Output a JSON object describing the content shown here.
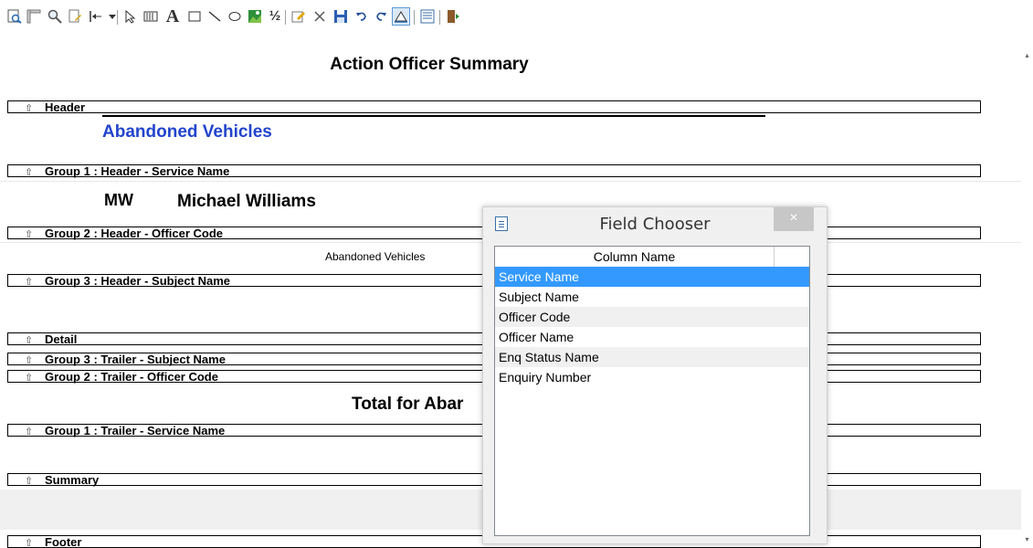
{
  "toolbar": {
    "tools": [
      {
        "name": "print-preview-icon",
        "glyph": "🔍"
      },
      {
        "name": "ruler-icon",
        "glyph": "📐"
      },
      {
        "name": "zoom-icon",
        "glyph": "🔎"
      },
      {
        "name": "properties-icon",
        "glyph": "📝"
      },
      {
        "name": "align-left-icon",
        "glyph": "⇤"
      },
      {
        "name": "align-dropdown-icon",
        "glyph": "▾"
      },
      {
        "name": "pointer-icon",
        "glyph": "⇖"
      },
      {
        "name": "field-icon",
        "glyph": "▦"
      },
      {
        "name": "text-icon",
        "glyph": "A"
      },
      {
        "name": "rectangle-icon",
        "glyph": "□"
      },
      {
        "name": "line-icon",
        "glyph": "╲"
      },
      {
        "name": "ellipse-icon",
        "glyph": "○"
      },
      {
        "name": "image-icon",
        "glyph": "▣"
      },
      {
        "name": "formula-icon",
        "glyph": "½"
      },
      {
        "name": "edit-icon",
        "glyph": "✎"
      },
      {
        "name": "delete-icon",
        "glyph": "✕"
      },
      {
        "name": "save-icon",
        "glyph": "💾"
      },
      {
        "name": "undo-icon",
        "glyph": "↶"
      },
      {
        "name": "redo-icon",
        "glyph": "↷"
      },
      {
        "name": "field-chooser-icon",
        "glyph": "▲"
      },
      {
        "name": "list-icon",
        "glyph": "☰"
      },
      {
        "name": "exit-icon",
        "glyph": "⇥"
      }
    ]
  },
  "report": {
    "title": "Action Officer Summary",
    "header_band": "Header",
    "abandoned_title": "Abandoned Vehicles",
    "group1_header": "Group 1 : Header - Service Name",
    "officer_code": "MW",
    "officer_name": "Michael Williams",
    "group2_header": "Group 2 : Header - Officer Code",
    "subject_value": "Abandoned Vehicles",
    "group3_header": "Group 3 : Header - Subject Name",
    "detail": "Detail",
    "group3_trailer": "Group 3 : Trailer - Subject Name",
    "group2_trailer": "Group 2 : Trailer - Officer Code",
    "total_label": "Total for Abar",
    "group1_trailer": "Group 1 : Trailer - Service Name",
    "summary": "Summary",
    "footer": "Footer",
    "band_arrow": "⇧"
  },
  "dialog": {
    "title": "Field Chooser",
    "close": "×",
    "column_header": "Column Name",
    "fields": [
      "Service Name",
      "Subject Name",
      "Officer Code",
      "Officer Name",
      "Enq Status Name",
      "Enquiry Number"
    ],
    "selected_index": 0,
    "accent_color": "#3399ff"
  }
}
